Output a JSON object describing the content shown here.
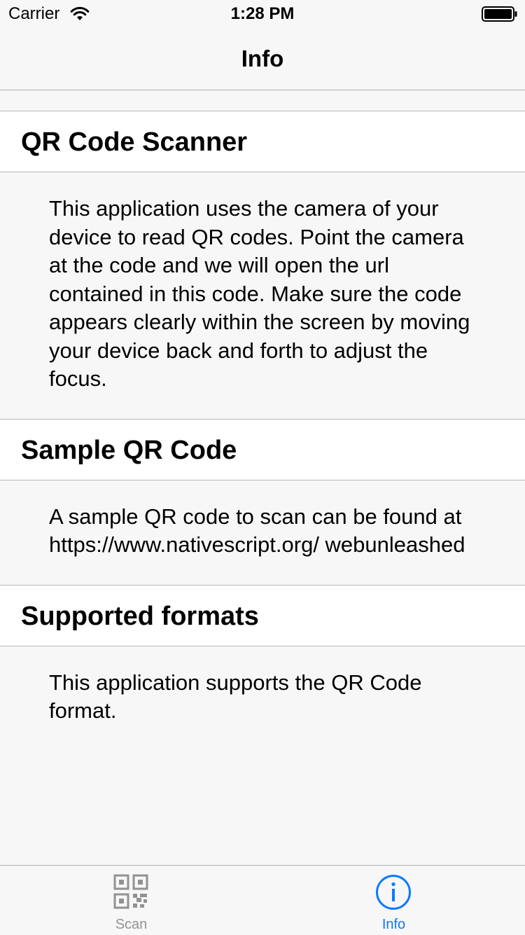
{
  "status_bar": {
    "carrier": "Carrier",
    "time": "1:28 PM"
  },
  "nav": {
    "title": "Info"
  },
  "sections": [
    {
      "title": "QR Code Scanner",
      "body": "This application uses the camera of your device to read QR codes. Point the camera at the code and we will open the url contained in this code. Make sure the code appears clearly within the screen by moving your device back and forth to adjust the focus."
    },
    {
      "title": "Sample QR Code",
      "body": "A sample QR code to scan can be found at https://www.nativescript.org/ webunleashed"
    },
    {
      "title": "Supported formats",
      "body": "This application supports the QR Code format."
    }
  ],
  "tabs": [
    {
      "label": "Scan",
      "icon": "qr-code-icon",
      "active": false
    },
    {
      "label": "Info",
      "icon": "info-icon",
      "active": true
    }
  ],
  "colors": {
    "accent": "#0a7aff",
    "inactive_tab": "#929292",
    "background": "#f7f7f7",
    "separator": "#b8b8b8"
  }
}
